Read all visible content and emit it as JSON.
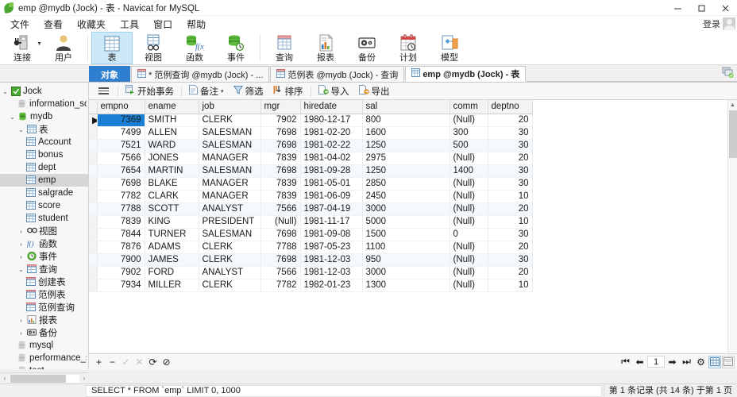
{
  "window": {
    "title": "emp @mydb (Jock) - 表 - Navicat for MySQL",
    "logo_icon": "navicat-leaf-logo",
    "minimize_icon": "minimize-icon",
    "maximize_icon": "maximize-icon",
    "close_icon": "close-icon"
  },
  "menubar": {
    "items": [
      {
        "label": "文件",
        "name": "menu-file"
      },
      {
        "label": "查看",
        "name": "menu-view"
      },
      {
        "label": "收藏夹",
        "name": "menu-favorites"
      },
      {
        "label": "工具",
        "name": "menu-tools"
      },
      {
        "label": "窗口",
        "name": "menu-window"
      },
      {
        "label": "帮助",
        "name": "menu-help"
      }
    ],
    "login_label": "登录",
    "avatar_icon": "user-avatar-icon"
  },
  "toolbar": {
    "items": [
      {
        "label": "连接",
        "icon": "connection-icon",
        "name": "toolbar-connection",
        "has_caret": true,
        "active": false
      },
      {
        "label": "用户",
        "icon": "user-icon",
        "name": "toolbar-user",
        "active": false
      },
      {
        "label": "表",
        "icon": "table-icon",
        "name": "toolbar-table",
        "active": true
      },
      {
        "label": "视图",
        "icon": "view-glasses-icon",
        "name": "toolbar-view",
        "active": false
      },
      {
        "label": "函数",
        "icon": "function-icon",
        "name": "toolbar-function",
        "active": false
      },
      {
        "label": "事件",
        "icon": "event-clock-icon",
        "name": "toolbar-event",
        "active": false
      },
      {
        "label": "查询",
        "icon": "query-icon",
        "name": "toolbar-query",
        "active": false
      },
      {
        "label": "报表",
        "icon": "report-chart-icon",
        "name": "toolbar-report",
        "active": false
      },
      {
        "label": "备份",
        "icon": "backup-tape-icon",
        "name": "toolbar-backup",
        "active": false
      },
      {
        "label": "计划",
        "icon": "schedule-calendar-icon",
        "name": "toolbar-schedule",
        "active": false
      },
      {
        "label": "模型",
        "icon": "model-diagram-icon",
        "name": "toolbar-model",
        "active": false
      }
    ]
  },
  "tabs": {
    "items": [
      {
        "label": "对象",
        "name": "tab-objects",
        "style": "object",
        "icon": ""
      },
      {
        "label": "* 范例查询 @mydb (Jock) - ...",
        "name": "tab-sample-query",
        "style": "normal",
        "icon": "query-tab-icon"
      },
      {
        "label": "范例表 @mydb (Jock) - 查询",
        "name": "tab-sample-table-query",
        "style": "normal",
        "icon": "query-tab-icon"
      },
      {
        "label": "emp @mydb (Jock) - 表",
        "name": "tab-emp-table",
        "style": "selected",
        "icon": "table-tab-icon"
      }
    ],
    "right_icon": "new-tab-icon"
  },
  "sidebar": {
    "nodes": [
      {
        "label": "Jock",
        "indent": 0,
        "twisty": "open",
        "icon": "connection-green-icon",
        "name": "tree-connection-jock",
        "selected": false
      },
      {
        "label": "information_scher",
        "indent": 1,
        "twisty": "",
        "icon": "database-icon",
        "name": "tree-db-information-schema",
        "selected": false
      },
      {
        "label": "mydb",
        "indent": 1,
        "twisty": "open",
        "icon": "database-active-icon",
        "name": "tree-db-mydb",
        "selected": false
      },
      {
        "label": "表",
        "indent": 2,
        "twisty": "open",
        "icon": "tables-folder-icon",
        "name": "tree-folder-tables",
        "selected": false
      },
      {
        "label": "Account",
        "indent": 3,
        "twisty": "",
        "icon": "table-icon",
        "name": "tree-table-account",
        "selected": false
      },
      {
        "label": "bonus",
        "indent": 3,
        "twisty": "",
        "icon": "table-icon",
        "name": "tree-table-bonus",
        "selected": false
      },
      {
        "label": "dept",
        "indent": 3,
        "twisty": "",
        "icon": "table-icon",
        "name": "tree-table-dept",
        "selected": false
      },
      {
        "label": "emp",
        "indent": 3,
        "twisty": "",
        "icon": "table-icon",
        "name": "tree-table-emp",
        "selected": true
      },
      {
        "label": "salgrade",
        "indent": 3,
        "twisty": "",
        "icon": "table-icon",
        "name": "tree-table-salgrade",
        "selected": false
      },
      {
        "label": "score",
        "indent": 3,
        "twisty": "",
        "icon": "table-icon",
        "name": "tree-table-score",
        "selected": false
      },
      {
        "label": "student",
        "indent": 3,
        "twisty": "",
        "icon": "table-icon",
        "name": "tree-table-student",
        "selected": false
      },
      {
        "label": "视图",
        "indent": 2,
        "twisty": "closed",
        "icon": "view-glasses-icon",
        "name": "tree-folder-views",
        "selected": false
      },
      {
        "label": "函数",
        "indent": 2,
        "twisty": "closed",
        "icon": "function-icon",
        "name": "tree-folder-functions",
        "selected": false
      },
      {
        "label": "事件",
        "indent": 2,
        "twisty": "closed",
        "icon": "event-clock-icon",
        "name": "tree-folder-events",
        "selected": false
      },
      {
        "label": "查询",
        "indent": 2,
        "twisty": "open",
        "icon": "query-icon",
        "name": "tree-folder-queries",
        "selected": false
      },
      {
        "label": "创建表",
        "indent": 3,
        "twisty": "",
        "icon": "query-icon",
        "name": "tree-query-create-table",
        "selected": false
      },
      {
        "label": "范例表",
        "indent": 3,
        "twisty": "",
        "icon": "query-icon",
        "name": "tree-query-sample-table",
        "selected": false
      },
      {
        "label": "范例查询",
        "indent": 3,
        "twisty": "",
        "icon": "query-icon",
        "name": "tree-query-sample-query",
        "selected": false
      },
      {
        "label": "报表",
        "indent": 2,
        "twisty": "closed",
        "icon": "report-icon",
        "name": "tree-folder-reports",
        "selected": false
      },
      {
        "label": "备份",
        "indent": 2,
        "twisty": "closed",
        "icon": "backup-icon",
        "name": "tree-folder-backups",
        "selected": false
      },
      {
        "label": "mysql",
        "indent": 1,
        "twisty": "",
        "icon": "database-icon",
        "name": "tree-db-mysql",
        "selected": false
      },
      {
        "label": "performance_sche",
        "indent": 1,
        "twisty": "",
        "icon": "database-icon",
        "name": "tree-db-performance-schema",
        "selected": false
      },
      {
        "label": "test",
        "indent": 1,
        "twisty": "",
        "icon": "database-icon",
        "name": "tree-db-test",
        "selected": false
      }
    ],
    "hscroll_left_icon": "scroll-left-icon",
    "hscroll_right_icon": "scroll-right-icon"
  },
  "actionbar": {
    "menu_icon": "hamburger-menu-icon",
    "items": [
      {
        "label": "开始事务",
        "icon": "begin-transaction-icon",
        "name": "action-begin-transaction",
        "caret": false
      },
      {
        "label": "备注",
        "icon": "note-icon",
        "name": "action-note",
        "caret": true
      },
      {
        "label": "筛选",
        "icon": "filter-icon",
        "name": "action-filter",
        "caret": false
      },
      {
        "label": "排序",
        "icon": "sort-icon",
        "name": "action-sort",
        "caret": false
      },
      {
        "label": "导入",
        "icon": "import-icon",
        "name": "action-import",
        "caret": false
      },
      {
        "label": "导出",
        "icon": "export-icon",
        "name": "action-export",
        "caret": false
      }
    ]
  },
  "grid": {
    "columns": [
      "empno",
      "ename",
      "job",
      "mgr",
      "hiredate",
      "sal",
      "comm",
      "deptno"
    ],
    "null_text": "(Null)",
    "selected_cell": {
      "row": 0,
      "column": "empno"
    },
    "rows": [
      {
        "empno": "7369",
        "ename": "SMITH",
        "job": "CLERK",
        "mgr": "7902",
        "hiredate": "1980-12-17",
        "sal": "800",
        "comm": "(Null)",
        "deptno": "20"
      },
      {
        "empno": "7499",
        "ename": "ALLEN",
        "job": "SALESMAN",
        "mgr": "7698",
        "hiredate": "1981-02-20",
        "sal": "1600",
        "comm": "300",
        "deptno": "30"
      },
      {
        "empno": "7521",
        "ename": "WARD",
        "job": "SALESMAN",
        "mgr": "7698",
        "hiredate": "1981-02-22",
        "sal": "1250",
        "comm": "500",
        "deptno": "30"
      },
      {
        "empno": "7566",
        "ename": "JONES",
        "job": "MANAGER",
        "mgr": "7839",
        "hiredate": "1981-04-02",
        "sal": "2975",
        "comm": "(Null)",
        "deptno": "20"
      },
      {
        "empno": "7654",
        "ename": "MARTIN",
        "job": "SALESMAN",
        "mgr": "7698",
        "hiredate": "1981-09-28",
        "sal": "1250",
        "comm": "1400",
        "deptno": "30"
      },
      {
        "empno": "7698",
        "ename": "BLAKE",
        "job": "MANAGER",
        "mgr": "7839",
        "hiredate": "1981-05-01",
        "sal": "2850",
        "comm": "(Null)",
        "deptno": "30"
      },
      {
        "empno": "7782",
        "ename": "CLARK",
        "job": "MANAGER",
        "mgr": "7839",
        "hiredate": "1981-06-09",
        "sal": "2450",
        "comm": "(Null)",
        "deptno": "10"
      },
      {
        "empno": "7788",
        "ename": "SCOTT",
        "job": "ANALYST",
        "mgr": "7566",
        "hiredate": "1987-04-19",
        "sal": "3000",
        "comm": "(Null)",
        "deptno": "20"
      },
      {
        "empno": "7839",
        "ename": "KING",
        "job": "PRESIDENT",
        "mgr": "(Null)",
        "hiredate": "1981-11-17",
        "sal": "5000",
        "comm": "(Null)",
        "deptno": "10"
      },
      {
        "empno": "7844",
        "ename": "TURNER",
        "job": "SALESMAN",
        "mgr": "7698",
        "hiredate": "1981-09-08",
        "sal": "1500",
        "comm": "0",
        "deptno": "30"
      },
      {
        "empno": "7876",
        "ename": "ADAMS",
        "job": "CLERK",
        "mgr": "7788",
        "hiredate": "1987-05-23",
        "sal": "1100",
        "comm": "(Null)",
        "deptno": "20"
      },
      {
        "empno": "7900",
        "ename": "JAMES",
        "job": "CLERK",
        "mgr": "7698",
        "hiredate": "1981-12-03",
        "sal": "950",
        "comm": "(Null)",
        "deptno": "30"
      },
      {
        "empno": "7902",
        "ename": "FORD",
        "job": "ANALYST",
        "mgr": "7566",
        "hiredate": "1981-12-03",
        "sal": "3000",
        "comm": "(Null)",
        "deptno": "20"
      },
      {
        "empno": "7934",
        "ename": "MILLER",
        "job": "CLERK",
        "mgr": "7782",
        "hiredate": "1982-01-23",
        "sal": "1300",
        "comm": "(Null)",
        "deptno": "10"
      }
    ]
  },
  "navbar": {
    "buttons": [
      {
        "icon": "plus-icon",
        "name": "add-record-button",
        "disabled": false,
        "glyph": "+"
      },
      {
        "icon": "minus-icon",
        "name": "delete-record-button",
        "disabled": false,
        "glyph": "−"
      },
      {
        "icon": "check-icon",
        "name": "apply-change-button",
        "disabled": true,
        "glyph": "✓"
      },
      {
        "icon": "cross-icon",
        "name": "discard-change-button",
        "disabled": true,
        "glyph": "✕"
      },
      {
        "icon": "refresh-icon",
        "name": "refresh-button",
        "disabled": false,
        "glyph": "⟳"
      },
      {
        "icon": "stop-icon",
        "name": "stop-button",
        "disabled": false,
        "glyph": "⊘"
      }
    ],
    "page_value": "1",
    "pager": [
      {
        "icon": "first-page-icon",
        "name": "first-page-button",
        "glyph": "⏮"
      },
      {
        "icon": "prev-page-icon",
        "name": "prev-page-button",
        "glyph": "⬅"
      },
      {
        "icon": "next-page-icon",
        "name": "next-page-button",
        "glyph": "➡"
      },
      {
        "icon": "last-page-icon",
        "name": "last-page-button",
        "glyph": "⏭"
      },
      {
        "icon": "gear-icon",
        "name": "page-settings-button",
        "glyph": "⚙"
      }
    ],
    "view_grid_icon": "grid-view-icon",
    "view_form_icon": "form-view-icon"
  },
  "statusbar": {
    "sql": "SELECT * FROM `emp` LIMIT 0, 1000",
    "record_info": "第 1 条记录 (共 14 条) 于第 1 页"
  },
  "colors": {
    "accent": "#1a7fd4",
    "tab_active": "#2f7fd0",
    "toolbar_active": "#cde8f7",
    "null_text": "#b4b4b4",
    "chrome": "#f0f0f0"
  }
}
